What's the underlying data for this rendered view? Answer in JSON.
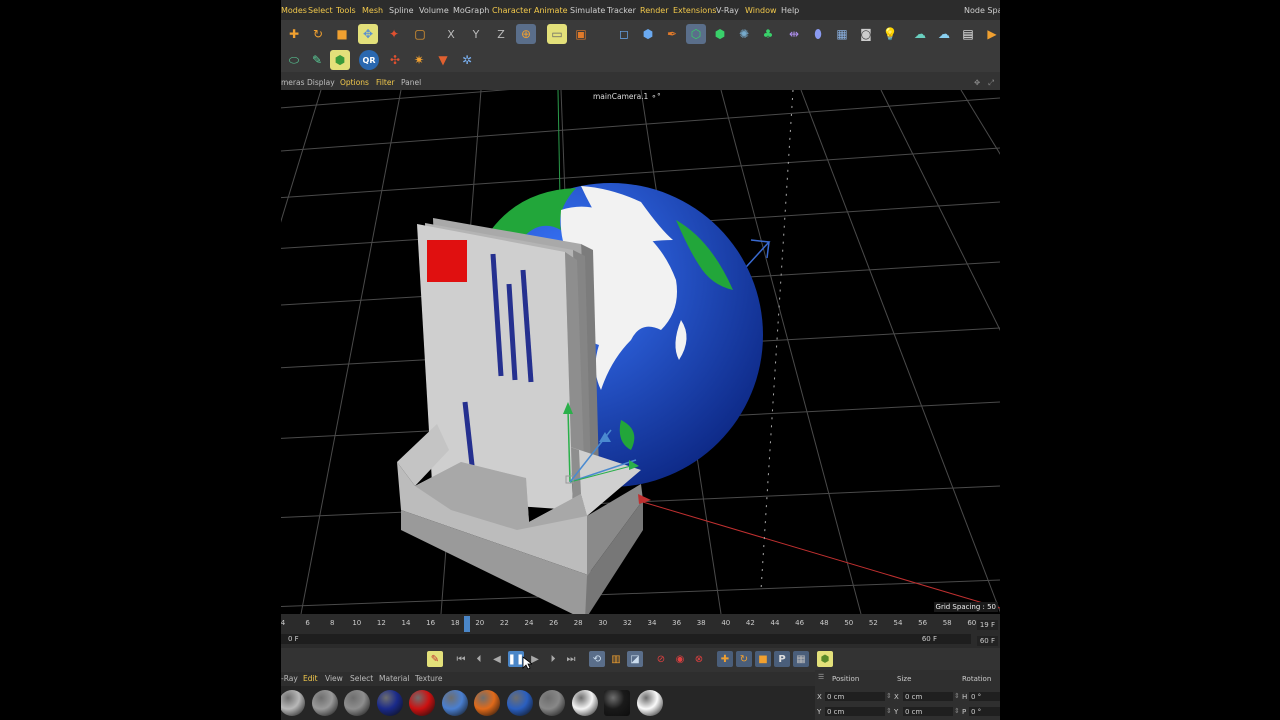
{
  "menu": [
    "Modes",
    "Select",
    "Tools",
    "Mesh",
    "Spline",
    "Volume",
    "MoGraph",
    "Character",
    "Animate",
    "Simulate",
    "Tracker",
    "Render",
    "Extensions",
    "V-Ray",
    "Window",
    "Help"
  ],
  "menu_right": "Node Spac",
  "toolbar1_icons": [
    "move-icon",
    "rotate-icon",
    "scale-icon",
    "live-select-icon",
    "tweak-icon",
    "rectangle-select-icon",
    "x-axis-lock-icon",
    "y-axis-lock-icon",
    "z-axis-lock-icon",
    "world-coordinates-icon",
    "render-region-icon",
    "render-view-icon",
    "cube-icon",
    "pen-icon",
    "subdivision-icon",
    "extrude-icon",
    "cloner-icon",
    "bend-icon",
    "boole-icon",
    "rectangle-spline-icon",
    "floor-icon",
    "camera-icon",
    "light-icon",
    "cloud-icon",
    "sky-icon",
    "clapper-icon",
    "play-render-icon"
  ],
  "toolbar1_labels": {
    "x": "X",
    "y": "Y",
    "z": "Z"
  },
  "toolbar2_icons": [
    "capsule-icon",
    "paint-icon",
    "material-tag-icon",
    "qr-icon",
    "particles-icon",
    "emitter-icon",
    "force-icon",
    "vray-icon"
  ],
  "toolbar2_labels": {
    "qr": "QR"
  },
  "viewport_menu": [
    "meras",
    "Display",
    "Options",
    "Filter",
    "Panel"
  ],
  "viewport": {
    "camera_label": "mainCamera.1",
    "grid_spacing": "Grid Spacing : 50"
  },
  "timeline": {
    "ticks": [
      "4",
      "6",
      "8",
      "10",
      "12",
      "14",
      "16",
      "18",
      "20",
      "22",
      "24",
      "26",
      "28",
      "30",
      "32",
      "34",
      "36",
      "38",
      "40",
      "42",
      "44",
      "46",
      "48",
      "50",
      "52",
      "54",
      "56",
      "58",
      "60"
    ],
    "current_frame": "19 F",
    "end_frame": "60 F",
    "range_start": "0 F",
    "range_end": "60 F"
  },
  "transport_icons": [
    "key-icon",
    "go-start-icon",
    "prev-key-icon",
    "prev-frame-icon",
    "pause-icon",
    "next-frame-icon",
    "next-key-icon",
    "go-end-icon",
    "loop-icon",
    "timeline-icon",
    "record-icon",
    "autokey-icon",
    "keyframe-icon",
    "move-key-icon",
    "rotate-key-icon",
    "scale-key-icon",
    "param-key-icon",
    "pla-key-icon"
  ],
  "transport_labels": {
    "param": "P"
  },
  "material_menu": [
    "-Ray",
    "Edit",
    "View",
    "Select",
    "Material",
    "Texture"
  ],
  "materials": [
    "#b8b8b8",
    "#9a9a9a",
    "#8e8e8e",
    "#1a2a8a",
    "#cc1111",
    "#4a7fd0",
    "#e06a1a",
    "#2a5fc0",
    "#888888",
    "#f4f4f4",
    "#1a1a1a",
    "#fafafa"
  ],
  "attributes": {
    "headers": [
      "Position",
      "Size",
      "Rotation"
    ],
    "rows": [
      {
        "pos_label": "X",
        "pos": "0 cm",
        "size_label": "X",
        "size": "0 cm",
        "rot_label": "H",
        "rot": "0 °"
      },
      {
        "pos_label": "Y",
        "pos": "0 cm",
        "size_label": "Y",
        "size": "0 cm",
        "rot_label": "P",
        "rot": "0 °"
      }
    ]
  },
  "colors": {
    "accent": "#f2c94c",
    "playhead": "#4a86c8",
    "ocean": "#1f4fc9",
    "land": "#22a63a",
    "ice": "#f2f2f2",
    "stamp": "#e01010",
    "stripe": "#25308f"
  }
}
